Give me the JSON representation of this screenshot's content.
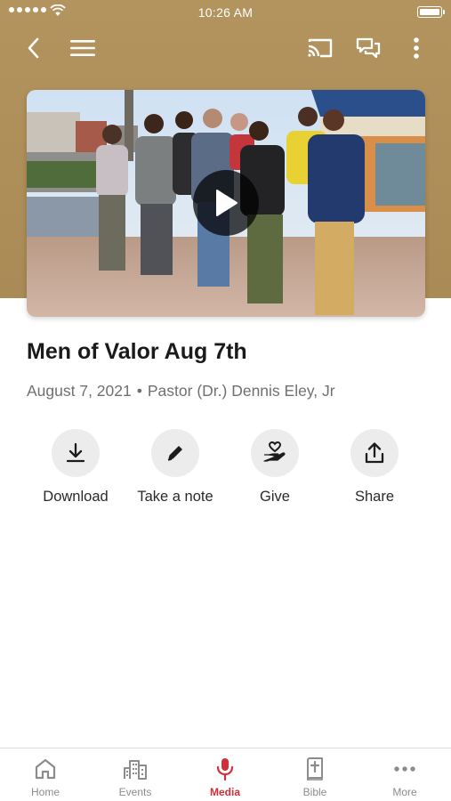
{
  "status_bar": {
    "time": "10:26 AM"
  },
  "colors": {
    "header_bg": "#b3945e",
    "accent": "#d0303c",
    "tab_inactive": "#8c8c8c"
  },
  "top_nav": {
    "back_icon": "chevron-left-icon",
    "menu_icon": "hamburger-menu-icon",
    "cast_icon": "cast-icon",
    "chat_icon": "chat-bubbles-icon",
    "more_icon": "vertical-dots-icon"
  },
  "media": {
    "title": "Men of Valor Aug 7th",
    "date": "August 7, 2021",
    "separator": "•",
    "speaker": "Pastor (Dr.) Dennis Eley, Jr"
  },
  "actions": [
    {
      "label": "Download",
      "icon": "download-icon"
    },
    {
      "label": "Take a note",
      "icon": "pencil-icon"
    },
    {
      "label": "Give",
      "icon": "giving-hand-heart-icon"
    },
    {
      "label": "Share",
      "icon": "share-upload-icon"
    }
  ],
  "tabs": [
    {
      "label": "Home",
      "icon": "home-icon",
      "active": false
    },
    {
      "label": "Events",
      "icon": "city-buildings-icon",
      "active": false
    },
    {
      "label": "Media",
      "icon": "microphone-icon",
      "active": true
    },
    {
      "label": "Bible",
      "icon": "bible-cross-icon",
      "active": false
    },
    {
      "label": "More",
      "icon": "horizontal-dots-icon",
      "active": false
    }
  ]
}
